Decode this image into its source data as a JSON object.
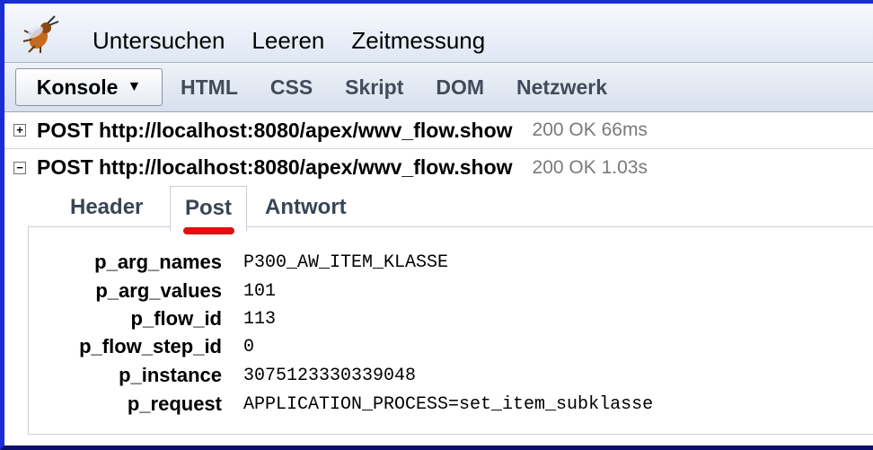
{
  "toolbar": {
    "icon": "firebug-icon",
    "menu": [
      "Untersuchen",
      "Leeren",
      "Zeitmessung"
    ]
  },
  "panels": {
    "konsole": "Konsole",
    "tabs": [
      "HTML",
      "CSS",
      "Skript",
      "DOM",
      "Netzwerk"
    ]
  },
  "requests": [
    {
      "toggle": "+",
      "label": "POST http://localhost:8080/apex/wwv_flow.show",
      "status": "200 OK 66ms"
    },
    {
      "toggle": "−",
      "label": "POST http://localhost:8080/apex/wwv_flow.show",
      "status": "200 OK 1.03s"
    }
  ],
  "subtabs": [
    "Header",
    "Post",
    "Antwort"
  ],
  "active_subtab": "Post",
  "params": [
    {
      "name": "p_arg_names",
      "value": "P300_AW_ITEM_KLASSE"
    },
    {
      "name": "p_arg_values",
      "value": "101"
    },
    {
      "name": "p_flow_id",
      "value": "113"
    },
    {
      "name": "p_flow_step_id",
      "value": "0"
    },
    {
      "name": "p_instance",
      "value": "3075123330339048"
    },
    {
      "name": "p_request",
      "value": "APPLICATION_PROCESS=set_item_subklasse"
    }
  ],
  "colors": {
    "frame_border": "#1b2bd6",
    "highlight_underline": "#e21010",
    "status_text": "#7a7a7a"
  }
}
